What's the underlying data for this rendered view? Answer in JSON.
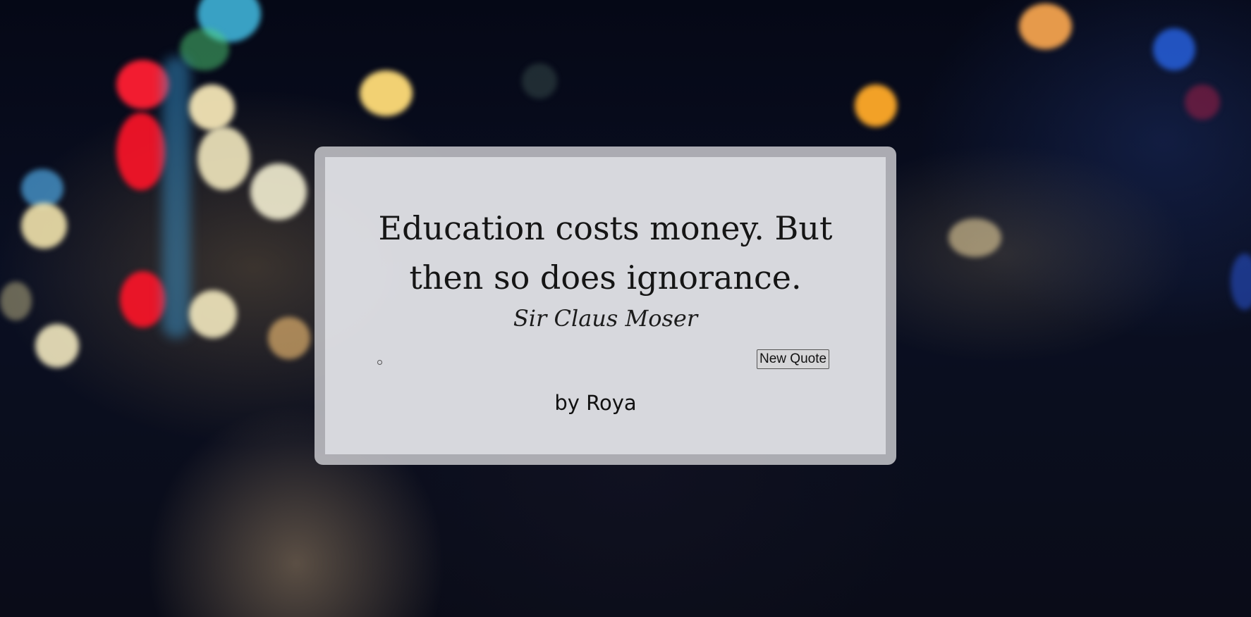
{
  "quote": {
    "text": "Education costs money. But then so does ignorance.",
    "author": "Sir Claus Moser"
  },
  "controls": {
    "new_quote_label": "New Quote"
  },
  "footer": {
    "credit": "by Roya"
  }
}
